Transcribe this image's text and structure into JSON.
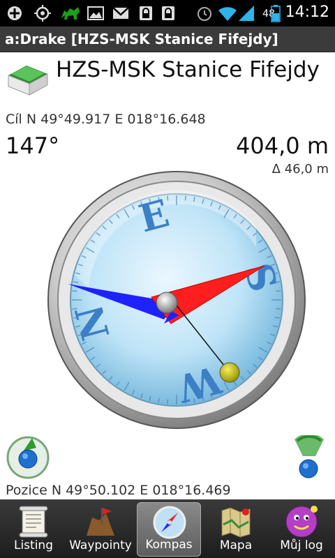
{
  "status_bar": {
    "time": "14:12",
    "battery_level": "48",
    "icons": [
      "add-icon",
      "gps-target-icon",
      "green-animal-icon",
      "image-icon",
      "gmail-icon",
      "lock-icon",
      "lock-icon",
      "alarm-icon",
      "wifi-icon",
      "signal-icon",
      "battery-icon"
    ]
  },
  "title_bar": {
    "title": "a:Drake [HZS-MSK Stanice Fifejdy]"
  },
  "cache": {
    "name": "HZS-MSK Stanice Fifejdy"
  },
  "target": {
    "label": "Cíl",
    "coords": "N 49°49.917 E 018°16.648"
  },
  "bearing": "147°",
  "distance": "404,0 m",
  "elevation_diff": "Δ 46,0 m",
  "compass": {
    "letters": [
      "N",
      "E",
      "S",
      "W"
    ]
  },
  "position": {
    "label": "Pozice",
    "coords": "N 49°50.102 E 018°16.469"
  },
  "tabs": [
    {
      "label": "Listing",
      "icon": "scroll-icon",
      "active": false
    },
    {
      "label": "Waypointy",
      "icon": "flag-icon",
      "active": false
    },
    {
      "label": "Kompas",
      "icon": "compass-icon",
      "active": true
    },
    {
      "label": "Mapa",
      "icon": "map-icon",
      "active": false
    },
    {
      "label": "Můj log",
      "icon": "smiley-icon",
      "active": false
    }
  ],
  "colors": {
    "needle_red": "#ff1e1e",
    "needle_blue": "#1e22ff",
    "compass_face": "#a8d8f0",
    "letters": "#3d7fc6",
    "title_bar": "#3b3b3b"
  }
}
